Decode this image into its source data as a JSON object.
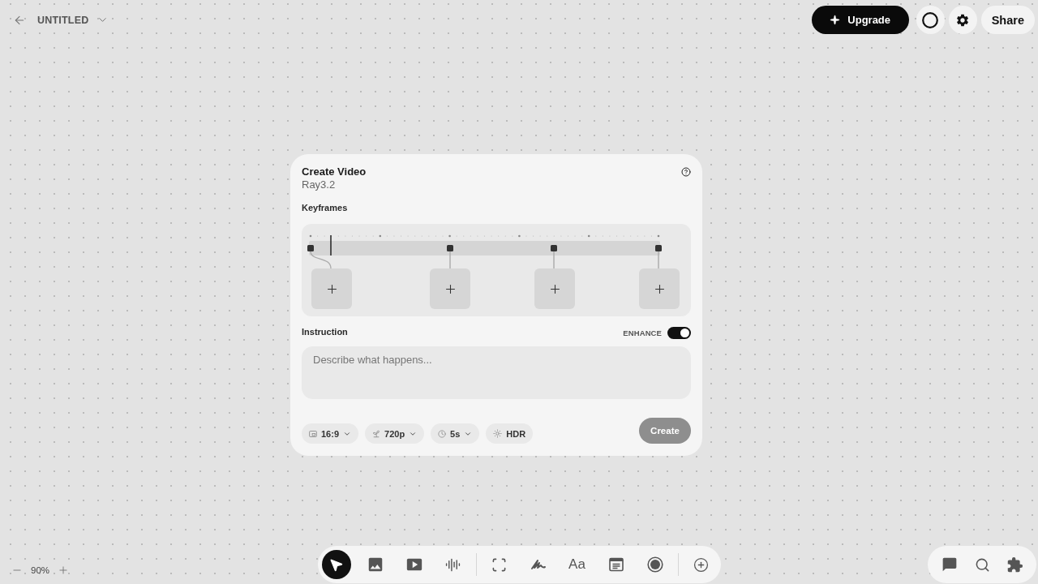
{
  "header": {
    "title": "UNTITLED"
  },
  "actions": {
    "upgrade": "Upgrade",
    "share": "Share"
  },
  "card": {
    "title": "Create Video",
    "model": "Ray3.2",
    "keyframes": {
      "label": "Keyframes"
    },
    "instruction": {
      "label": "Instruction",
      "placeholder": "Describe what happens..."
    },
    "enhance": {
      "label": "ENHANCE",
      "on": true
    },
    "settings": [
      {
        "kind": "dropdown",
        "label": "16:9"
      },
      {
        "kind": "dropdown",
        "label": "720p"
      },
      {
        "kind": "dropdown",
        "label": "5s"
      },
      {
        "kind": "toggle",
        "label": "HDR"
      }
    ],
    "create": {
      "label": "Create",
      "disabled": true
    }
  },
  "toolbar": {
    "groups": [
      {
        "tools": [
          {
            "selected": true
          },
          {
            "selected": false
          },
          {
            "selected": false
          },
          {
            "selected": false
          }
        ]
      },
      {
        "tools": [
          {
            "selected": false
          },
          {
            "selected": false
          },
          {
            "label": "Aa",
            "selected": false
          },
          {
            "selected": false
          },
          {
            "selected": false
          }
        ]
      },
      {
        "tools": [
          {
            "selected": false
          }
        ]
      }
    ]
  },
  "zoom": {
    "value": "90%"
  }
}
